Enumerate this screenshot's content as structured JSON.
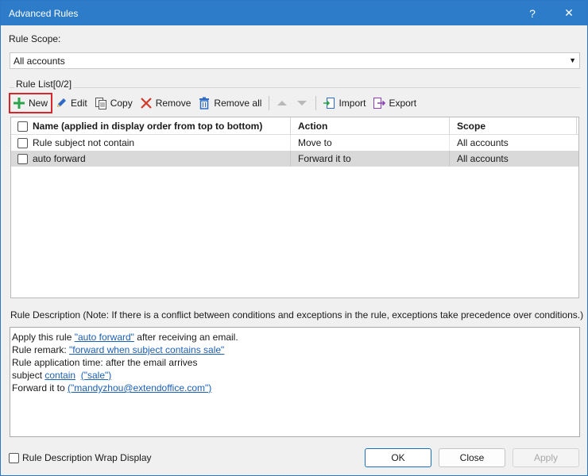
{
  "window": {
    "title": "Advanced Rules",
    "help_glyph": "?",
    "close_glyph": "✕"
  },
  "scope": {
    "label": "Rule Scope:",
    "selected": "All accounts"
  },
  "rule_list": {
    "group_label": "Rule List[0/2]",
    "toolbar": {
      "new": "New",
      "edit": "Edit",
      "copy": "Copy",
      "remove": "Remove",
      "remove_all": "Remove all",
      "import": "Import",
      "export": "Export"
    },
    "columns": {
      "name": "Name (applied in display order from top to bottom)",
      "action": "Action",
      "scope": "Scope"
    },
    "rows": [
      {
        "name": "Rule subject not contain",
        "action": "Move to",
        "scope": "All accounts",
        "checked": false
      },
      {
        "name": "auto forward",
        "action": "Forward it to",
        "scope": "All accounts",
        "checked": false
      }
    ]
  },
  "description": {
    "label": "Rule Description (Note: If there is a conflict between conditions and exceptions in the rule, exceptions take precedence over conditions.)",
    "line1_pre": "Apply this rule ",
    "line1_link": "\"auto forward\"",
    "line1_post": " after receiving an email.",
    "line2_pre": "Rule remark: ",
    "line2_link": "\"forward when subject contains sale\"",
    "line3": "Rule application time: after the email arrives",
    "line4_pre": "subject ",
    "line4_link1": "contain",
    "line4_link2": "(\"sale\")",
    "line5_pre": "Forward it to ",
    "line5_link": "(\"mandyzhou@extendoffice.com\")"
  },
  "footer": {
    "wrap_label": "Rule Description Wrap Display",
    "ok": "OK",
    "close": "Close",
    "apply": "Apply"
  },
  "colors": {
    "titlebar": "#2d7cc9",
    "link": "#1a5fb4",
    "highlight": "#d9262c",
    "selected_row": "#d9d9d9"
  },
  "icons": {
    "new": "plus-icon",
    "edit": "pencil-icon",
    "copy": "copy-icon",
    "remove": "x-icon",
    "remove_all": "trash-icon",
    "up": "arrow-up-icon",
    "down": "arrow-down-icon",
    "import": "import-icon",
    "export": "export-icon"
  }
}
